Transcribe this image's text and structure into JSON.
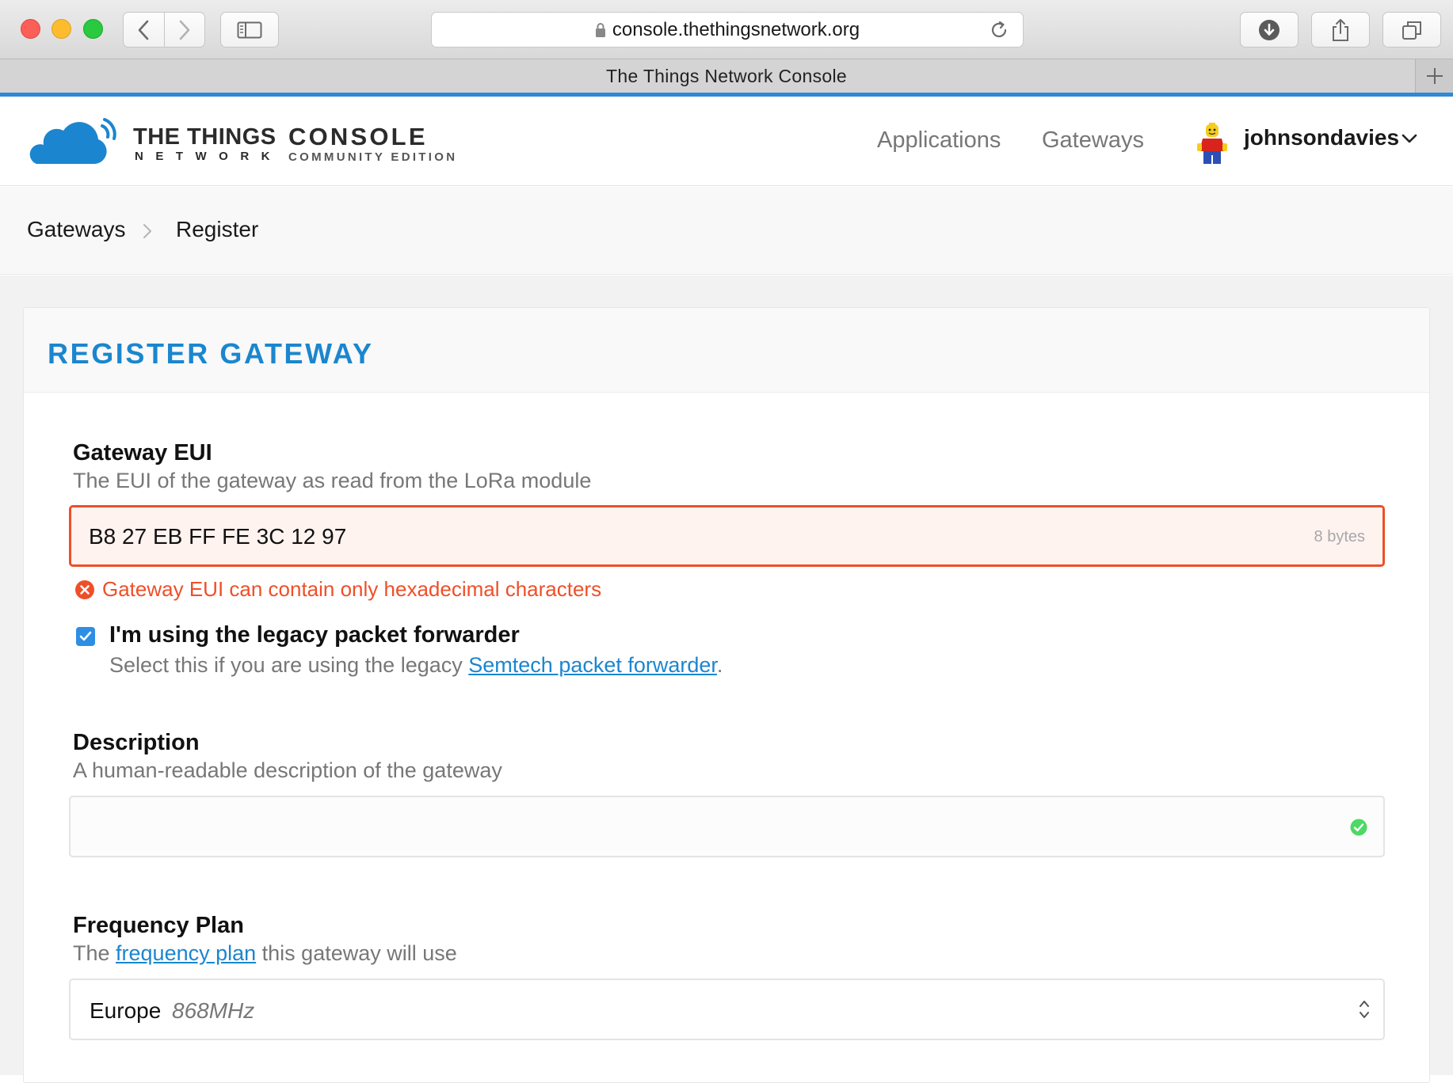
{
  "browser": {
    "url": "console.thethingsnetwork.org",
    "tab_title": "The Things Network Console"
  },
  "header": {
    "brand_line1": "THE THINGS",
    "brand_line2": "NETWORK",
    "console_title": "CONSOLE",
    "console_subtitle": "COMMUNITY EDITION",
    "nav": {
      "applications": "Applications",
      "gateways": "Gateways"
    },
    "username": "johnsondavies"
  },
  "breadcrumb": {
    "gateways": "Gateways",
    "register": "Register"
  },
  "card": {
    "title": "REGISTER GATEWAY",
    "eui": {
      "label": "Gateway EUI",
      "help": "The EUI of the gateway as read from the LoRa module",
      "value": "B8 27 EB FF FE 3C 12 97",
      "unit": "8 bytes",
      "error": "Gateway EUI can contain only hexadecimal characters"
    },
    "legacy": {
      "label": "I'm using the legacy packet forwarder",
      "help_prefix": "Select this if you are using the legacy ",
      "help_link": "Semtech packet forwarder",
      "help_suffix": ".",
      "checked": true
    },
    "description": {
      "label": "Description",
      "help": "A human-readable description of the gateway",
      "value": ""
    },
    "frequency": {
      "label": "Frequency Plan",
      "help_prefix": "The ",
      "help_link": "frequency plan",
      "help_suffix": " this gateway will use",
      "selected_region": "Europe",
      "selected_freq": "868MHz"
    }
  },
  "colors": {
    "accent": "#1b86cf",
    "error": "#ef4f28",
    "success": "#4cd964",
    "tab_underline": "#2d8ad6"
  }
}
